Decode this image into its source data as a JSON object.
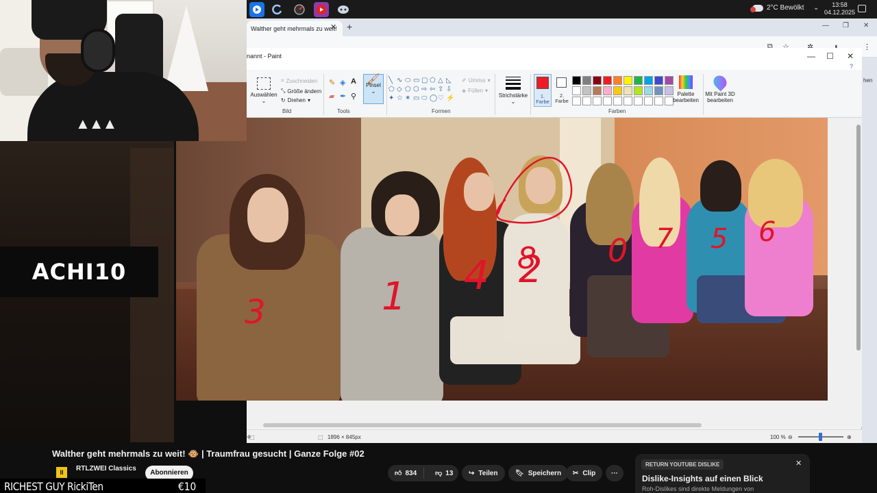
{
  "taskbar": {
    "apps": [
      "app-blue-icon",
      "refresh-c-icon",
      "speedometer-icon",
      "youtube-icon",
      "discord-icon"
    ],
    "weather": "2°C Bewölkt",
    "time": "13:58",
    "date": "04.12.2025"
  },
  "browser": {
    "tab_title": "Walther geht mehrmals zu weit!",
    "new_tab": "+",
    "right_edge_text": "hen"
  },
  "paint": {
    "title": "nannt - Paint",
    "groups": {
      "bild": "Bild",
      "tools": "Tools",
      "formen": "Formen",
      "farben": "Farben"
    },
    "select_label": "Auswählen",
    "crop_label": "Zuschneiden",
    "resize_label": "Größe ändern",
    "rotate_label": "Drehen",
    "brush_label": "Pinsel",
    "outline_label": "Umriss",
    "fill_label": "Füllen",
    "stroke_label": "Strichstärke",
    "color1_label": "1. Farbe",
    "color2_label": "2. Farbe",
    "palette_edit_label": "Palette bearbeiten",
    "paint3d_label": "Mit Paint 3D bearbeiten",
    "color1_value": "#ed1c24",
    "color2_value": "#ffffff",
    "palette_row1": [
      "#000000",
      "#7f7f7f",
      "#880015",
      "#ed1c24",
      "#ff7f27",
      "#fff200",
      "#22b14c",
      "#00a2e8",
      "#3f48cc",
      "#a349a4"
    ],
    "palette_row2": [
      "#ffffff",
      "#c3c3c3",
      "#b97a57",
      "#ffaec9",
      "#ffc90e",
      "#efe4b0",
      "#b5e61d",
      "#99d9ea",
      "#7092be",
      "#c8bfe7"
    ],
    "palette_row3": [
      "#ffffff",
      "#ffffff",
      "#ffffff",
      "#ffffff",
      "#ffffff",
      "#ffffff",
      "#ffffff",
      "#ffffff",
      "#ffffff",
      "#ffffff"
    ],
    "image_size": "1896 × 845px",
    "zoom": "100 %",
    "annotations": [
      "3",
      "1",
      "4",
      "2",
      "8",
      "0",
      "7",
      "5",
      "6"
    ]
  },
  "channel_logo": "ACHI10",
  "youtube": {
    "video_title": "Walther geht mehrmals zu weit! 🐵 | Traumfrau gesucht | Ganze Folge #02",
    "channel_name": "RTLZWEI Classics",
    "subscribe": "Abonnieren",
    "likes": "834",
    "dislikes": "13",
    "share": "Teilen",
    "save": "Speichern",
    "clip": "Clip",
    "more": "···",
    "rytd_badge": "RETURN YOUTUBE DISLIKE",
    "rytd_title": "Dislike-Insights auf einen Blick",
    "rytd_desc": "Roh-Dislikes sind direkte Meldungen von"
  },
  "ticker": {
    "text": "RICHEST GUY RickiTen",
    "amount": "€10"
  }
}
